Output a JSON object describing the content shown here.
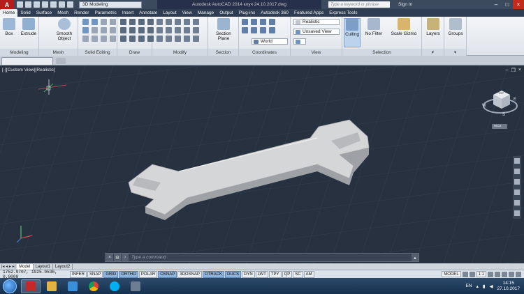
{
  "titlebar": {
    "app_letter": "A",
    "workspace": "3D Modeling",
    "title": "Autodesk AutoCAD 2014  клуч 24.10.2017.dwg",
    "search_placeholder": "Type a keyword or phrase",
    "signin": "Sign In"
  },
  "tabs": [
    "Home",
    "Solid",
    "Surface",
    "Mesh",
    "Render",
    "Parametric",
    "Insert",
    "Annotate",
    "Layout",
    "View",
    "Manage",
    "Output",
    "Plug-ins",
    "Autodesk 360",
    "Featured Apps",
    "Express Tools"
  ],
  "active_tab": "Home",
  "ribbon": {
    "box_label": "Box",
    "extrude_label": "Extrude",
    "smooth_object_label": "Smooth Object",
    "section_plane_label": "Section Plane",
    "visual_style": "Realistic",
    "view_state": "Unsaved View",
    "ucs": "World",
    "culling_label": "Culling",
    "no_filter_label": "No Filter",
    "scale_gizmo_label": "Scale Gizmo",
    "layers_label": "Layers",
    "groups_label": "Groups",
    "panels": [
      "Modeling",
      "Mesh",
      "Solid Editing",
      "Draw",
      "Modify",
      "Section",
      "Coordinates",
      "View",
      "Selection"
    ]
  },
  "viewport": {
    "label": "[-][Custom View][Realistic]",
    "viewcube_top": "TOP",
    "viewcube_compass": {
      "w": "W",
      "s": "S",
      "e": "E"
    },
    "wcs": "WCS"
  },
  "command": {
    "placeholder": "Type a command"
  },
  "layout_tabs": [
    "Model",
    "Layout1",
    "Layout2"
  ],
  "status": {
    "coords": "1752.9707, 1925.0536, 0.0000",
    "buttons": [
      {
        "label": "INFER",
        "on": false
      },
      {
        "label": "SNAP",
        "on": false
      },
      {
        "label": "GRID",
        "on": true
      },
      {
        "label": "ORTHO",
        "on": true
      },
      {
        "label": "POLAR",
        "on": false
      },
      {
        "label": "OSNAP",
        "on": true
      },
      {
        "label": "3DOSNAP",
        "on": false
      },
      {
        "label": "OTRACK",
        "on": true
      },
      {
        "label": "DUCS",
        "on": true
      },
      {
        "label": "DYN",
        "on": false
      },
      {
        "label": "LWT",
        "on": false
      },
      {
        "label": "TPY",
        "on": false
      },
      {
        "label": "QP",
        "on": false
      },
      {
        "label": "SC",
        "on": false
      },
      {
        "label": "AM",
        "on": false
      }
    ],
    "model": "MODEL",
    "scale": "1:1"
  },
  "taskbar": {
    "lang": "EN",
    "time": "14:15",
    "date": "27.10.2017"
  },
  "colors": {
    "autocad_red": "#b71c1c",
    "viewport_bg": "#273140",
    "wrench": "#d9dadb"
  }
}
